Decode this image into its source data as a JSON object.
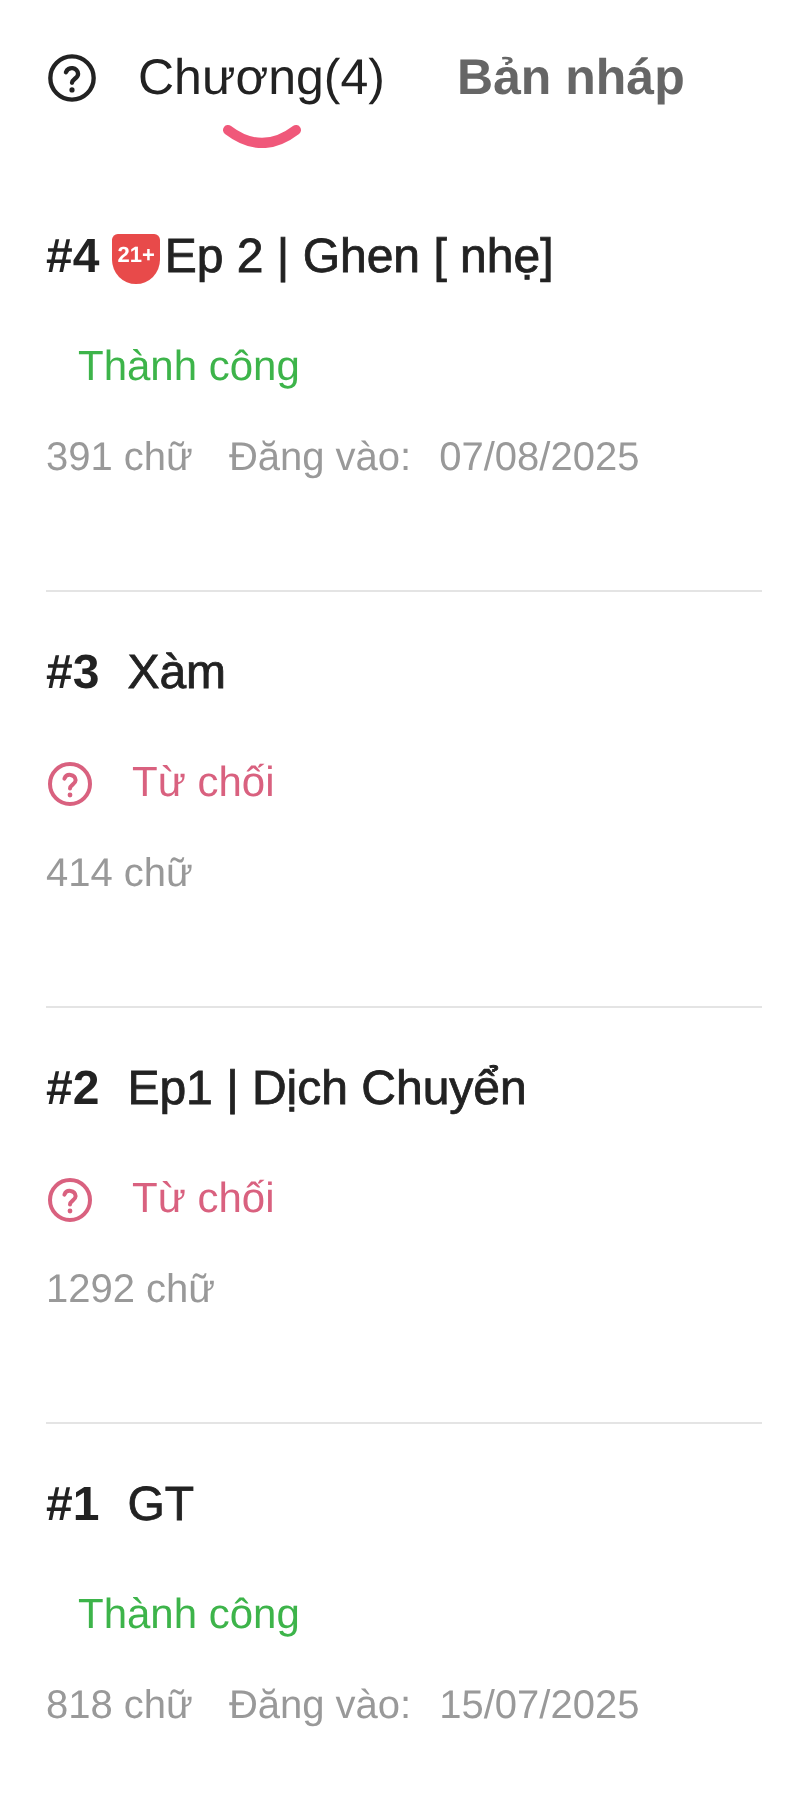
{
  "tabs": [
    {
      "label": "Chương(4)",
      "selected": true
    },
    {
      "label": "Bản nháp",
      "selected": false
    }
  ],
  "chapters": [
    {
      "number": "#4",
      "badge": "21+",
      "title": "Ep 2 | Ghen [ nhẹ]",
      "status": {
        "kind": "success",
        "label": "Thành công"
      },
      "words": "391 chữ",
      "posted_label": "Đăng vào:",
      "posted_date": "07/08/2025"
    },
    {
      "number": "#3",
      "title": "Xàm",
      "status": {
        "kind": "rejected",
        "label": "Từ chối"
      },
      "words": "414 chữ"
    },
    {
      "number": "#2",
      "title": "Ep1 | Dịch Chuyển",
      "status": {
        "kind": "rejected",
        "label": "Từ chối"
      },
      "words": "1292 chữ"
    },
    {
      "number": "#1",
      "title": "GT",
      "status": {
        "kind": "success",
        "label": "Thành công"
      },
      "words": "818 chữ",
      "posted_label": "Đăng vào:",
      "posted_date": "15/07/2025"
    }
  ]
}
